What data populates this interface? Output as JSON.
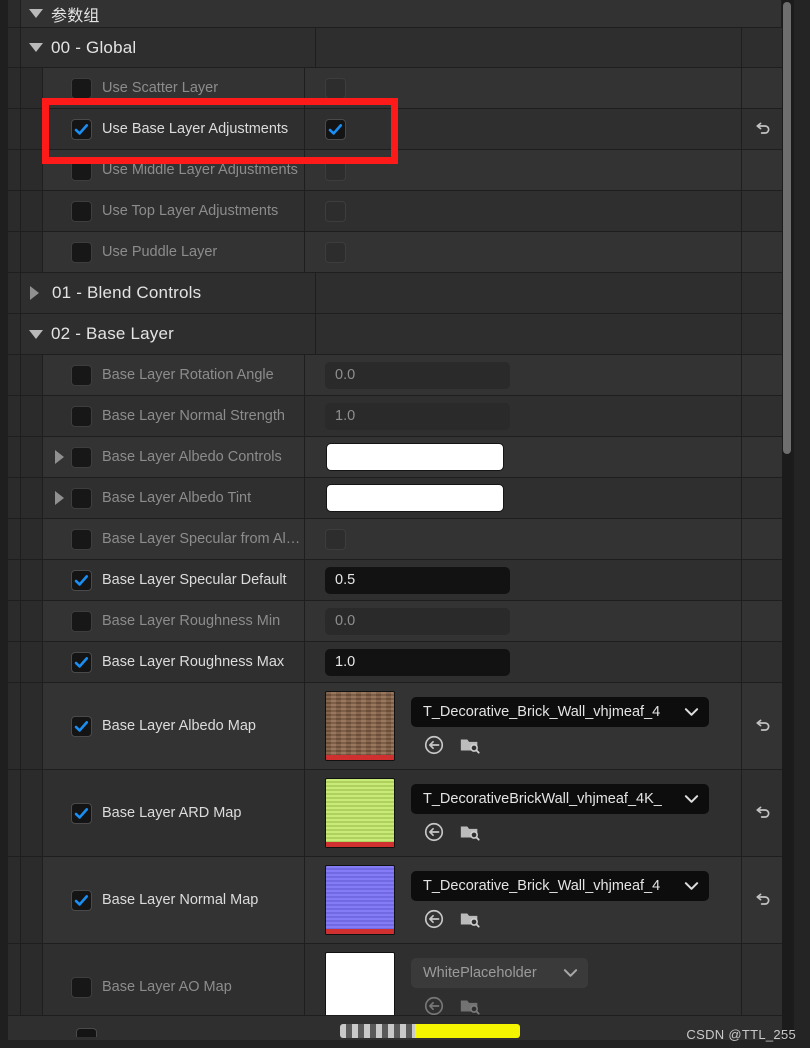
{
  "panel": {
    "header": {
      "label": "参数组",
      "expander": "chevron-down-icon"
    }
  },
  "categories": [
    {
      "id": "global",
      "label": "00 - Global",
      "expanded": true
    },
    {
      "id": "blend",
      "label": "01 - Blend Controls",
      "expanded": false
    },
    {
      "id": "base",
      "label": "02 - Base Layer",
      "expanded": true
    }
  ],
  "rows": {
    "use_scatter_layer": {
      "label": "Use Scatter Layer",
      "checked": false,
      "enabled": false
    },
    "use_base_layer_adjustments": {
      "label": "Use Base Layer Adjustments",
      "checked": true,
      "enabled": true
    },
    "use_middle_layer_adjustments": {
      "label": "Use Middle Layer Adjustments",
      "checked": false,
      "enabled": false
    },
    "use_top_layer_adjustments": {
      "label": "Use Top Layer Adjustments",
      "checked": false,
      "enabled": false
    },
    "use_puddle_layer": {
      "label": "Use Puddle Layer",
      "checked": false,
      "enabled": false
    },
    "base_rotation_angle": {
      "label": "Base Layer Rotation Angle",
      "checked": false,
      "enabled": false,
      "value": "0.0"
    },
    "base_normal_strength": {
      "label": "Base Layer Normal Strength",
      "checked": false,
      "enabled": false,
      "value": "1.0"
    },
    "base_albedo_controls": {
      "label": "Base Layer Albedo Controls",
      "checked": false,
      "enabled": false,
      "swatch": "#ffffff"
    },
    "base_albedo_tint": {
      "label": "Base Layer Albedo Tint",
      "checked": false,
      "enabled": false,
      "swatch": "#ffffff"
    },
    "base_specular_from_albedo": {
      "label": "Base Layer Specular from Al…",
      "checked": false,
      "enabled": false
    },
    "base_specular_default": {
      "label": "Base Layer Specular Default",
      "checked": true,
      "enabled": true,
      "value": "0.5"
    },
    "base_roughness_min": {
      "label": "Base Layer Roughness Min",
      "checked": false,
      "enabled": false,
      "value": "0.0"
    },
    "base_roughness_max": {
      "label": "Base Layer Roughness Max",
      "checked": true,
      "enabled": true,
      "value": "1.0"
    },
    "base_albedo_map": {
      "label": "Base Layer Albedo Map",
      "checked": true,
      "enabled": true,
      "asset": "T_Decorative_Brick_Wall_vhjmeaf_4",
      "thumb_color": "#8b6549",
      "has_reset": true
    },
    "base_ard_map": {
      "label": "Base Layer ARD Map",
      "checked": true,
      "enabled": true,
      "asset": "T_DecorativeBrickWall_vhjmeaf_4K_",
      "thumb_color": "#c3e86a",
      "has_reset": true
    },
    "base_normal_map": {
      "label": "Base Layer Normal Map",
      "checked": true,
      "enabled": true,
      "asset": "T_Decorative_Brick_Wall_vhjmeaf_4",
      "thumb_color": "#7b72f5",
      "has_reset": true
    },
    "base_ao_map": {
      "label": "Base Layer AO Map",
      "checked": false,
      "enabled": false,
      "asset": "WhitePlaceholder",
      "thumb_color": "#ffffff",
      "has_reset": false
    }
  },
  "asset_actions": {
    "use_selected": "use-selected-asset-icon",
    "browse": "browse-to-asset-icon",
    "dropdown": "chevron-down-icon",
    "reset": "reset-to-default-icon"
  },
  "highlight": {
    "color": "#ff1a1a",
    "target": "use_base_layer_adjustments"
  },
  "watermark": {
    "text": "CSDN @TTL_255"
  },
  "scrollbar": {
    "orientation": "vertical",
    "thumb_color": "#6e6e6e"
  }
}
